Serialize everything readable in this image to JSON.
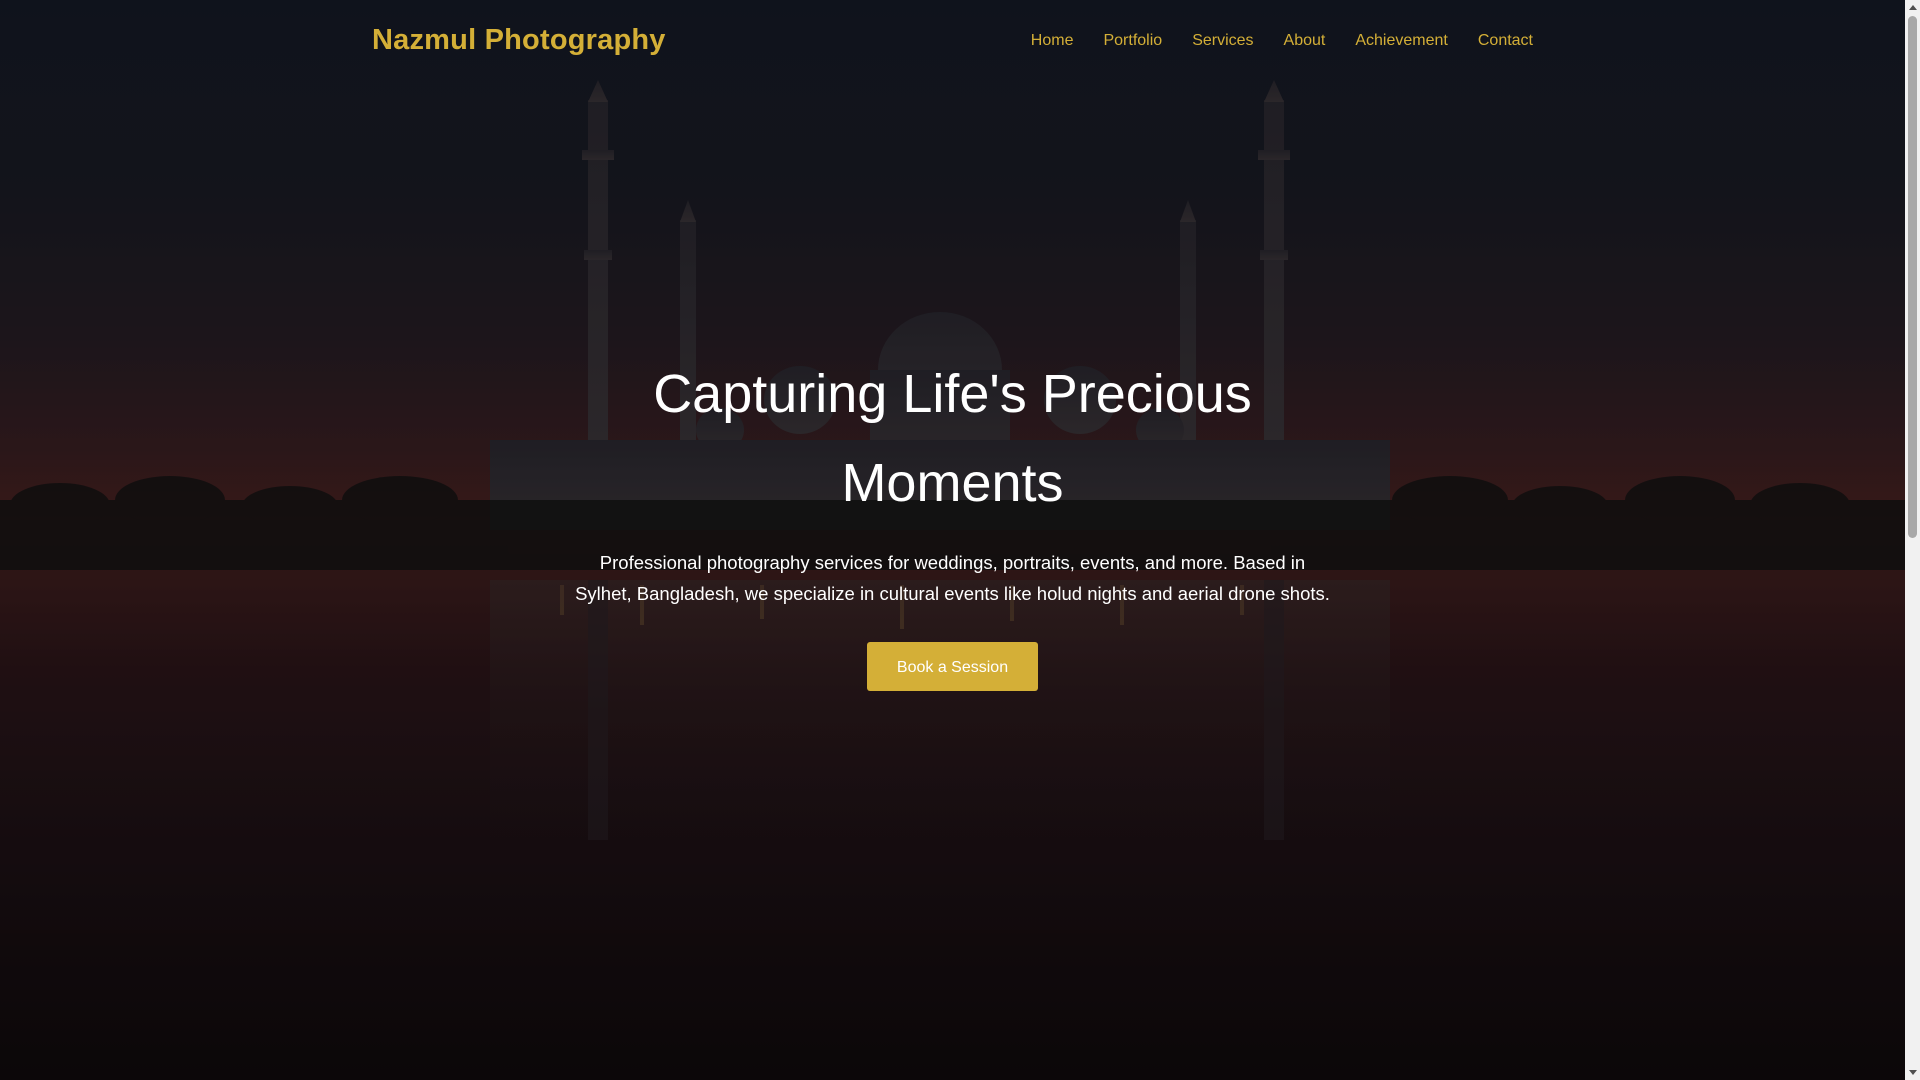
{
  "brand": {
    "name": "Nazmul Photography"
  },
  "nav": {
    "items": [
      {
        "label": "Home"
      },
      {
        "label": "Portfolio"
      },
      {
        "label": "Services"
      },
      {
        "label": "About"
      },
      {
        "label": "Achievement"
      },
      {
        "label": "Contact"
      }
    ]
  },
  "hero": {
    "title": "Capturing Life's Precious Moments",
    "text": "Professional photography services for weddings, portraits, events, and more. Based in Sylhet, Bangladesh, we specialize in cultural events like holud nights and aerial drone shots.",
    "cta_label": "Book a Session",
    "background_image": "mosque-at-dusk-reflection"
  },
  "colors": {
    "accent": "#d4af37",
    "text": "#ffffff"
  }
}
